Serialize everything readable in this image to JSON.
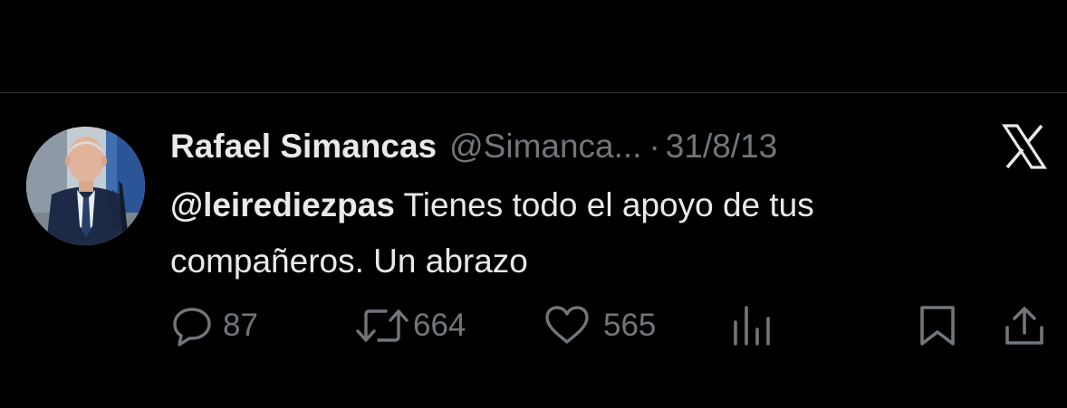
{
  "tweet": {
    "author_name": "Rafael Simancas",
    "handle": "@Simanca...",
    "separator": "·",
    "date": "31/8/13",
    "mention": "@leirediezpas",
    "text": " Tienes todo el apoyo de tus compañeros. Un abrazo"
  },
  "actions": {
    "replies": "87",
    "retweets": "664",
    "likes": "565"
  },
  "colors": {
    "background": "#000000",
    "primary_text": "#e7e9ea",
    "secondary_text": "#71767b",
    "divider": "#2f3336"
  },
  "icons": {
    "platform_logo": "x-logo-icon",
    "reply": "reply-icon",
    "retweet": "retweet-icon",
    "like": "heart-icon",
    "views": "views-icon",
    "bookmark": "bookmark-icon",
    "share": "share-icon"
  }
}
